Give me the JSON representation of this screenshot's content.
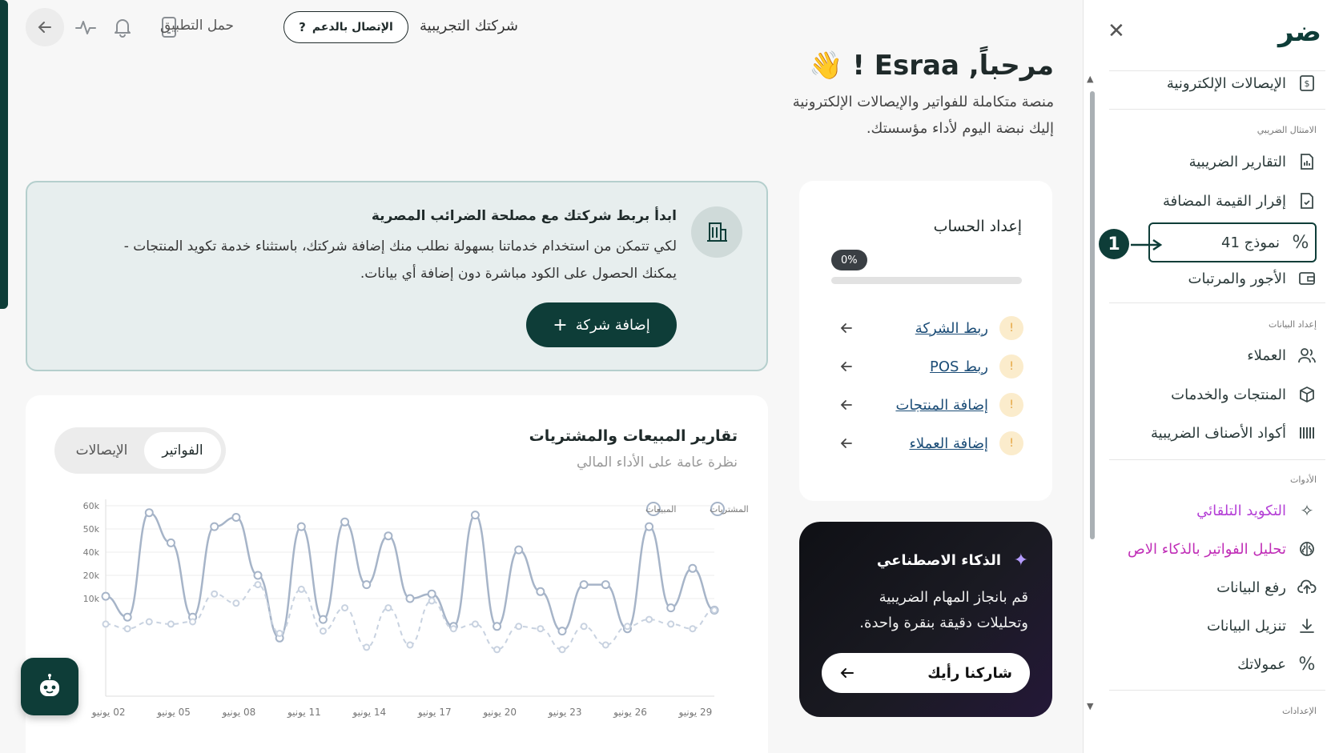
{
  "topbar": {
    "company": "شركتك التجريبية",
    "support": "الإتصال بالدعم",
    "download_app": "حمل التطبيق"
  },
  "welcome": {
    "title": "مرحباً, Esraa ! 👋",
    "subtitle1": "منصة متكاملة للفواتير والإيصالات الإلكترونية",
    "subtitle2": "إليك نبضة اليوم لأداء مؤسستك."
  },
  "tax_banner": {
    "title": "ابدأ بربط شركتك مع مصلحة الضرائب المصرية",
    "desc1": "لكي تتمكن من استخدام خدماتنا بسهولة نطلب منك إضافة شركتك، باستثناء خدمة تكويد المنتجات -",
    "desc2": "يمكنك الحصول على الكود مباشرة دون إضافة أي بيانات.",
    "button": "إضافة شركة"
  },
  "setup": {
    "title": "إعداد الحساب",
    "progress_label": "0%",
    "progress": 0,
    "items": [
      {
        "label": "ربط الشركة"
      },
      {
        "label": "ربط POS"
      },
      {
        "label": "إضافة المنتجات"
      },
      {
        "label": "إضافة العملاء"
      }
    ]
  },
  "ai": {
    "title": "الذكاء الاصطناعي",
    "desc1": "قم بانجاز المهام الضريبية",
    "desc2": "وتحليلات دقيقة بنقرة واحدة.",
    "button": "شاركنا رأيك"
  },
  "chart_card": {
    "title": "تقارير المبيعات والمشتريات",
    "subtitle": "نظرة عامة على الأداء المالي",
    "toggle": {
      "invoices": "الفواتير",
      "receipts": "الإيصالات"
    }
  },
  "chart_data": {
    "type": "line",
    "legend": [
      "المبيعات",
      "المشتريات"
    ],
    "legend_position": "top-right",
    "yticks": [
      "60k",
      "50k",
      "40k",
      "20k",
      "10k"
    ],
    "ytick_values": [
      60,
      50,
      40,
      30,
      20
    ],
    "ylim": [
      0,
      62
    ],
    "xticks": [
      "02 يونيو",
      "05 يونيو",
      "08 يونيو",
      "11 يونيو",
      "14 يونيو",
      "17 يونيو",
      "20 يونيو",
      "23 يونيو",
      "26 يونيو",
      "29 يونيو"
    ],
    "xtick_days": [
      2,
      5,
      8,
      11,
      14,
      17,
      20,
      23,
      26,
      29
    ],
    "x_days": [
      1.5,
      2.5,
      3.5,
      4.5,
      5.5,
      6.5,
      7.5,
      8.5,
      9.5,
      10.5,
      11.5,
      12.5,
      13.5,
      14.5,
      15.5,
      16.5,
      17.5,
      18.5,
      19.5,
      20.5,
      21.5,
      22.5,
      23.5,
      24.5,
      25.5,
      26.5,
      27.5,
      28.5,
      29.5
    ],
    "series": [
      {
        "name": "المبيعات",
        "color": "#a6b4c8",
        "values": [
          21,
          12,
          57,
          44,
          12,
          51,
          55,
          30,
          3,
          51,
          11,
          53,
          26,
          47,
          20,
          22,
          8,
          56,
          8,
          41,
          23,
          6,
          26,
          26,
          7,
          51,
          16,
          33,
          15
        ]
      },
      {
        "name": "المشتريات",
        "color": "#c8d2e0",
        "values": [
          9,
          7,
          10,
          9,
          10,
          22,
          18,
          26,
          5,
          24,
          6,
          16,
          -1,
          16,
          0,
          19,
          7,
          9,
          -2,
          8,
          7,
          -2,
          8,
          0,
          8,
          11,
          9,
          7,
          15
        ]
      }
    ]
  },
  "sidebar": {
    "logo": "ضر",
    "items_top": [
      {
        "label": "الإيصالات الإلكترونية",
        "icon": "receipt-dollar-icon"
      }
    ],
    "sections": [
      {
        "title": "الامتثال الضريبي",
        "items": [
          {
            "label": "التقارير الضريبية",
            "icon": "report-icon"
          },
          {
            "label": "إقرار القيمة المضافة",
            "icon": "file-check-icon"
          },
          {
            "label": "نموذج 41",
            "icon": "percent-icon",
            "active": true
          },
          {
            "label": "الأجور والمرتبات",
            "icon": "wallet-icon"
          }
        ]
      },
      {
        "title": "إعداد البيانات",
        "items": [
          {
            "label": "العملاء",
            "icon": "users-icon"
          },
          {
            "label": "المنتجات والخدمات",
            "icon": "box-icon"
          },
          {
            "label": "أكواد الأصناف الضريبية",
            "icon": "barcode-icon"
          }
        ]
      },
      {
        "title": "الأدوات",
        "items": [
          {
            "label": "التكويد التلقائي",
            "icon": "sparkle-icon"
          },
          {
            "label": "تحليل الفواتير بالذكاء الاص",
            "icon": "brain-icon"
          },
          {
            "label": "رفع البيانات",
            "icon": "upload-icon"
          },
          {
            "label": "تنزيل البيانات",
            "icon": "download-icon"
          },
          {
            "label": "عمولاتك",
            "icon": "percent-icon"
          }
        ]
      },
      {
        "title": "الإعدادات",
        "items": []
      }
    ]
  },
  "annotation": {
    "marker": "1"
  },
  "colors": {
    "brand": "#0e3d38",
    "accent_purple": "#b43fd6",
    "link": "#1c4d77"
  }
}
